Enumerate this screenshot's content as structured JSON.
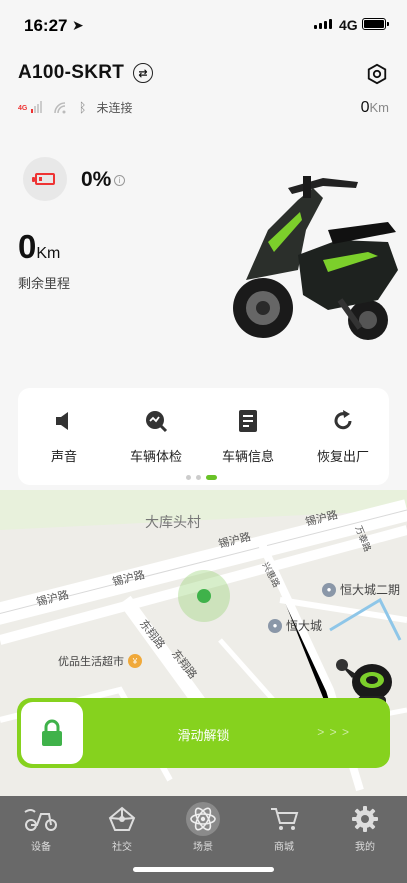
{
  "status_bar": {
    "time": "16:27",
    "network": "4G",
    "location_icon": "location-arrow-icon"
  },
  "header": {
    "vehicle_name": "A100-SKRT",
    "swap_icon": "swap-icon",
    "settings_icon": "hexagon-settings-icon"
  },
  "connection": {
    "network_badge": "4G",
    "status": "未连接"
  },
  "odometer": {
    "value": "0",
    "unit": "Km"
  },
  "battery": {
    "percent": "0%",
    "level": 0,
    "accent": "#e53935"
  },
  "range": {
    "value": "0",
    "unit": "Km",
    "label": "剩余里程"
  },
  "quick_actions": [
    {
      "label": "声音",
      "icon": "speaker-icon"
    },
    {
      "label": "车辆体检",
      "icon": "diagnostic-icon"
    },
    {
      "label": "车辆信息",
      "icon": "document-icon"
    },
    {
      "label": "恢复出厂",
      "icon": "reset-icon"
    }
  ],
  "pager": {
    "pages": 3,
    "active": 3
  },
  "map": {
    "district": "大库头村",
    "roads": [
      "锡沪路",
      "锡沪路",
      "锡沪路",
      "锡沪路",
      "东翔路",
      "东翔路",
      "兴惠路",
      "万泰路"
    ],
    "pois": [
      {
        "name": "恒大城二期",
        "icon": "poi-pin-icon"
      },
      {
        "name": "恒大城",
        "icon": "poi-pin-icon"
      },
      {
        "name": "优品生活超市",
        "icon": "shop-icon"
      }
    ]
  },
  "unlock": {
    "label": "滑动解锁",
    "hint": "> > >",
    "accent": "#86d21e"
  },
  "tabs": [
    {
      "label": "设备",
      "icon": "scooter-icon"
    },
    {
      "label": "社交",
      "icon": "network-icon"
    },
    {
      "label": "场景",
      "icon": "atom-icon"
    },
    {
      "label": "商城",
      "icon": "cart-icon"
    },
    {
      "label": "我的",
      "icon": "gear-icon"
    }
  ]
}
